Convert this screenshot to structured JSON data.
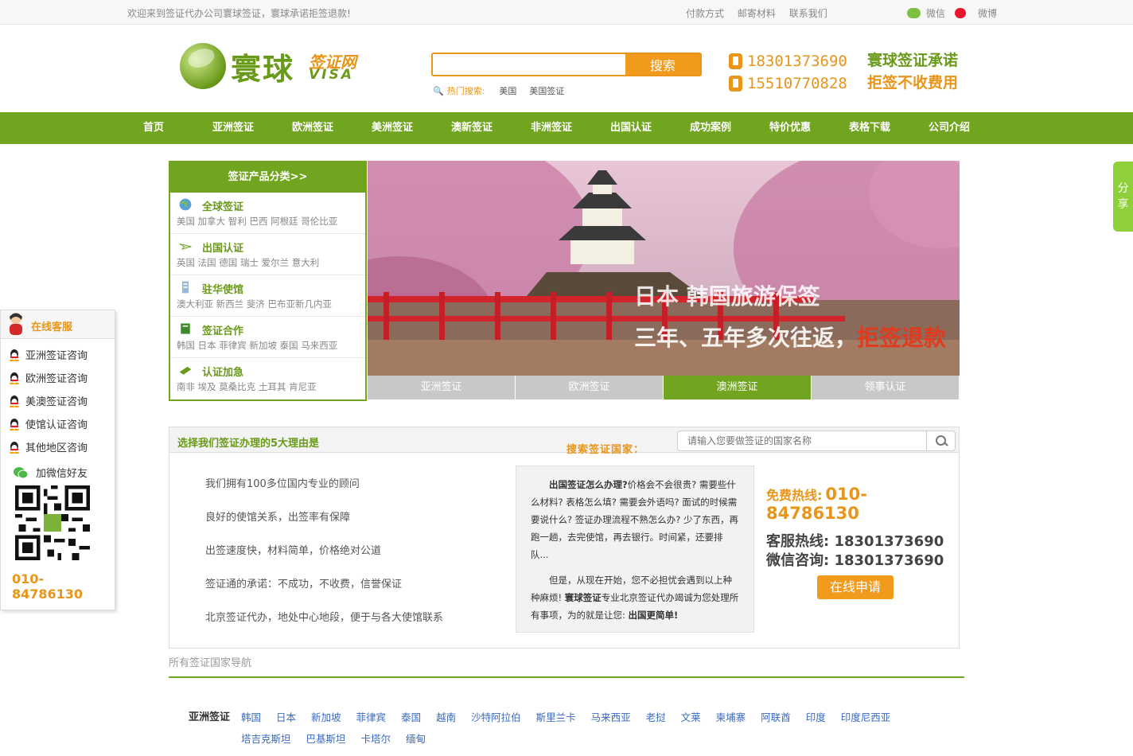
{
  "topbar": {
    "welcome": "欢迎来到签证代办公司寰球签证，寰球承诺拒签退款!",
    "links": [
      "付款方式",
      "邮寄材料",
      "联系我们"
    ],
    "wechat": "微信",
    "weibo": "微博"
  },
  "logo": {
    "big": "寰球",
    "small": "签证网",
    "visa": "VISA"
  },
  "search": {
    "button": "搜索",
    "placeholder": "",
    "hot_label": "热门搜索:",
    "hot_items": [
      "美国",
      "美国签证"
    ]
  },
  "phones": [
    "18301373690",
    "15510770828"
  ],
  "promise": {
    "line1": "寰球签证承诺",
    "line2": "拒签不收费用"
  },
  "nav": [
    "首页",
    "亚洲签证",
    "欧洲签证",
    "美洲签证",
    "澳新签证",
    "非洲签证",
    "出国认证",
    "成功案例",
    "特价优惠",
    "表格下载",
    "公司介绍"
  ],
  "category": {
    "title": "签证产品分类>>",
    "rows": [
      {
        "title": "全球签证",
        "sub": "美国 加拿大 智利 巴西 阿根廷 哥伦比亚"
      },
      {
        "title": "出国认证",
        "sub": "英国 法国 德国 瑞士 爱尔兰 意大利"
      },
      {
        "title": "驻华使馆",
        "sub": "澳大利亚 新西兰 斐济 巴布亚新几内亚"
      },
      {
        "title": "签证合作",
        "sub": "韩国 日本 菲律宾 新加坡 泰国 马来西亚"
      },
      {
        "title": "认证加急",
        "sub": "南非 埃及 莫桑比克 土耳其 肯尼亚"
      }
    ]
  },
  "banner": {
    "line1": "日本  韩国旅游保签",
    "line2a": "三年、五年多次往返，",
    "line2b": "拒签退款"
  },
  "banner_tabs": [
    "亚洲签证",
    "欧洲签证",
    "澳洲签证",
    "领事认证"
  ],
  "reasons": {
    "title": "选择我们签证办理的5大理由是",
    "search_label": "搜索签证国家：",
    "search_placeholder": "请输入您要做签证的国家名称",
    "items": [
      "我们拥有100多位国内专业的顾问",
      "良好的使馆关系，出签率有保障",
      "出签速度快，材料简单，价格绝对公道",
      "签证通的承诺：不成功，不收费，信誉保证",
      "北京签证代办，地处中心地段，便于与各大使馆联系"
    ],
    "story1_bold": "出国签证怎么办理?",
    "story1": "价格会不会很贵? 需要些什么材料? 表格怎么填? 需要会外语吗? 面试的时候需要说什么? 签证办理流程不熟怎么办? 少了东西，再跑一趟，去完使馆，再去银行。时间紧，还要排队...",
    "story2a": "但是，从现在开始，您不必担忧会遇到以上种种麻烦! ",
    "story2_bold": "寰球签证",
    "story2b": "专业北京签证代办竭诚为您处理所有事项，为的就是让您: ",
    "story2_end": "出国更简单!",
    "free_label": "免费热线:",
    "free_number": "010-84786130",
    "cs_label": "客服热线:",
    "cs_number": "18301373690",
    "wx_label": "微信咨询:",
    "wx_number": "18301373690",
    "apply": "在线申请"
  },
  "all_nav": "所有签证国家导航",
  "countries": {
    "label": "亚洲签证",
    "items": [
      "韩国",
      "日本",
      "新加坡",
      "菲律宾",
      "泰国",
      "越南",
      "沙特阿拉伯",
      "斯里兰卡",
      "马来西亚",
      "老挝",
      "文莱",
      "柬埔寨",
      "阿联酋",
      "印度",
      "印度尼西亚",
      "塔吉克斯坦",
      "巴基斯坦",
      "卡塔尔",
      "缅甸"
    ]
  },
  "cs_panel": {
    "title": "在线客服",
    "items": [
      "亚洲签证咨询",
      "欧洲签证咨询",
      "美澳签证咨询",
      "使馆认证咨询",
      "其他地区咨询"
    ],
    "wechat": "加微信好友",
    "number": "010-84786130"
  },
  "share": "分享",
  "colors": {
    "green": "#72a51f",
    "orange": "#e8951a",
    "link": "#3a6ac0"
  }
}
